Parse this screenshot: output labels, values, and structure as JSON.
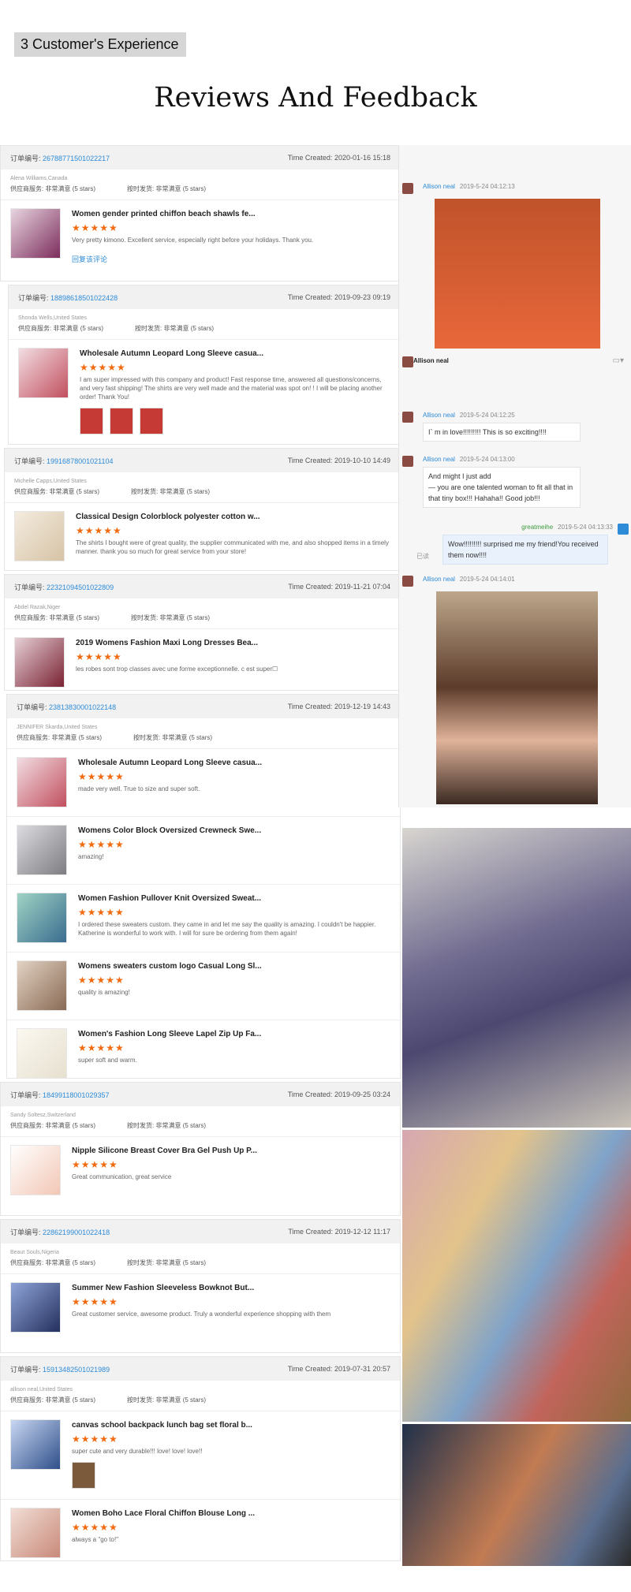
{
  "section_tag": "3 Customer's Experience",
  "title": "Reviews And Feedback",
  "labels": {
    "order_no": "订单编号:",
    "time_created": "Time Created:",
    "service": "供应商服务: 非常满意",
    "shipping": "按时发货: 非常满意",
    "five_stars": "(5 stars)",
    "reply": "回复该评论"
  },
  "orders": [
    {
      "number": "26788771501022217",
      "time": "2020-01-16 15:18",
      "buyer": "Alena Williams,Canada",
      "items": [
        {
          "title": "Women gender printed chiffon beach shawls fe...",
          "stars": "★★★★★",
          "comment": "Very pretty kimono.  Excellent service, especially right before your holidays.  Thank you.",
          "thumb": "#7c2d5c"
        }
      ]
    },
    {
      "number": "18898618501022428",
      "time": "2019-09-23 09:19",
      "buyer": "Shonda Wells,United States",
      "items": [
        {
          "title": "Wholesale Autumn Leopard Long Sleeve casua...",
          "stars": "★★★★★",
          "comment": "I am super impressed with this company and product! Fast response time, answered all questions/concerns, and very fast shipping! The shirts are very well made and the material was spot on! ! I will be placing another order! Thank You!",
          "thumb": "#c2505f"
        }
      ]
    },
    {
      "number": "19916878001021104",
      "time": "2019-10-10 14:49",
      "buyer": "Michelle Capps,United States",
      "items": [
        {
          "title": "Classical Design Colorblock polyester cotton w...",
          "stars": "★★★★★",
          "comment": "The shirts I bought were of great quality, the supplier communicated with me, and also shopped items in a timely manner. thank you so much for great service from your store!",
          "thumb": "#d6c3a5"
        }
      ]
    },
    {
      "number": "22321094501022809",
      "time": "2019-11-21 07:04",
      "buyer": "Abdel Razak,Niger",
      "items": [
        {
          "title": "2019 Womens Fashion Maxi Long Dresses Bea...",
          "stars": "★★★★★",
          "comment": "les robes sont trop classes avec une forme exceptionnelle. c est super☐",
          "thumb": "#7a2233"
        }
      ]
    },
    {
      "number": "23813830001022148",
      "time": "2019-12-19 14:43",
      "buyer": "JENNIFER Skarda,United States",
      "items": [
        {
          "title": "Wholesale Autumn Leopard Long Sleeve casua...",
          "stars": "★★★★★",
          "comment": "made very well. True to size and super soft.",
          "thumb": "#c2505f"
        },
        {
          "title": "Womens Color Block Oversized Crewneck Swe...",
          "stars": "★★★★★",
          "comment": "amazing!",
          "thumb": "#7d7d82"
        },
        {
          "title": "Women Fashion Pullover Knit Oversized Sweat...",
          "stars": "★★★★★",
          "comment": "I ordered these sweaters custom. they came in and let me say the quality is amazing. I couldn't be happier. Katherine is wonderful to work with. I will for sure be ordering from them again!",
          "thumb": "#3a6d8f"
        },
        {
          "title": "Womens sweaters custom logo Casual Long Sl...",
          "stars": "★★★★★",
          "comment": "quality is amazing!",
          "thumb": "#8a6b55"
        },
        {
          "title": "Women's Fashion Long Sleeve Lapel Zip Up Fa...",
          "stars": "★★★★★",
          "comment": "super soft and warm.",
          "thumb": "#e6e0cf"
        }
      ]
    },
    {
      "number": "18499118001029357",
      "time": "2019-09-25 03:24",
      "buyer": "Sandy Soltesz,Switzerland",
      "items": [
        {
          "title": "Nipple Silicone Breast Cover Bra Gel Push Up P...",
          "stars": "★★★★★",
          "comment": "Great communication, great service",
          "thumb": "#f2c7b5"
        }
      ]
    },
    {
      "number": "22862199001022418",
      "time": "2019-12-12 11:17",
      "buyer": "Beaut Souls,Nigeria",
      "items": [
        {
          "title": "Summer New Fashion Sleeveless Bowknot But...",
          "stars": "★★★★★",
          "comment": "Great customer service, awesome product. Truly a wonderful experience shopping with them",
          "thumb": "#24305e"
        }
      ]
    },
    {
      "number": "15913482501021989",
      "time": "2019-07-31 20:57",
      "buyer": "allison neal,United States",
      "items": [
        {
          "title": "canvas school backpack lunch bag set floral b...",
          "stars": "★★★★★",
          "comment": "super cute and very durable!!! love! love! love!!",
          "thumb": "#2f4f8a"
        },
        {
          "title": "Women Boho Lace Floral Chiffon Blouse Long ...",
          "stars": "★★★★★",
          "comment": "always a \"go to!\"",
          "thumb": "#c98a7a"
        }
      ]
    }
  ],
  "chat": {
    "messages": [
      {
        "name": "Allison neal",
        "time": "2019-5-24 04:12:13",
        "text": ""
      },
      {
        "name": "Allison neal",
        "time": "",
        "text": ""
      },
      {
        "name": "Allison neal",
        "time": "2019-5-24 04:12:25",
        "text": "I`  m in love!!!!!!!!! This is so exciting!!!!"
      },
      {
        "name": "Allison neal",
        "time": "2019-5-24 04:13:00",
        "text": "And might I just add\n— you are one talented woman to fit all that in that tiny box!!! Hahaha!! Good job!!!"
      },
      {
        "name": "greatmeihe",
        "time": "2019-5-24 04:13:33",
        "text": "Wow!!!!!!!!! surprised me my friend!You received them now!!!!",
        "read": "已读"
      },
      {
        "name": "Allison neal",
        "time": "2019-5-24 04:14:01",
        "text": ""
      }
    ]
  },
  "photos": {
    "rack1": "purple leopard sweater on rack",
    "rack2": "floral clothing rack",
    "rack3": "graphic tees rack"
  }
}
